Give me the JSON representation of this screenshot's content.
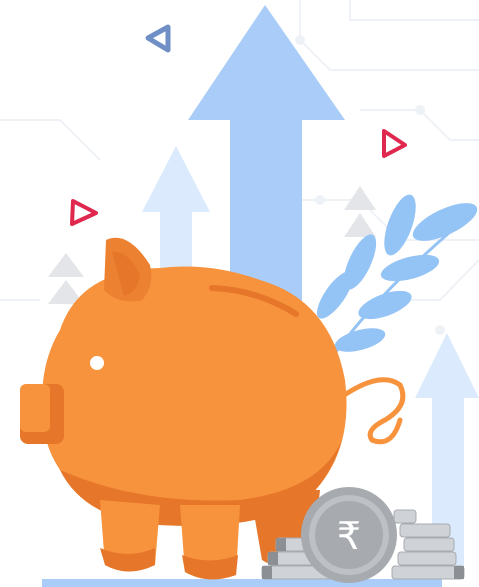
{
  "illustration": {
    "coin_symbol": "₹",
    "colors": {
      "background": "#ffffff",
      "circuit_lines": "#eef1f6",
      "arrow_primary": "#a9cdf8",
      "arrow_secondary": "#dbeafd",
      "triangle_gray": "#e3e5e8",
      "triangle_outline_red": "#e0284f",
      "triangle_outline_blue": "#6f8fc6",
      "leaf_blue": "#94c3f5",
      "pig_body": "#f7923d",
      "pig_shade": "#e6762a",
      "pig_ear": "#ec8131",
      "coin_silver": "#cfd2d6",
      "coin_dark": "#8c8f93",
      "ground_bar": "#a9cdf8"
    }
  }
}
